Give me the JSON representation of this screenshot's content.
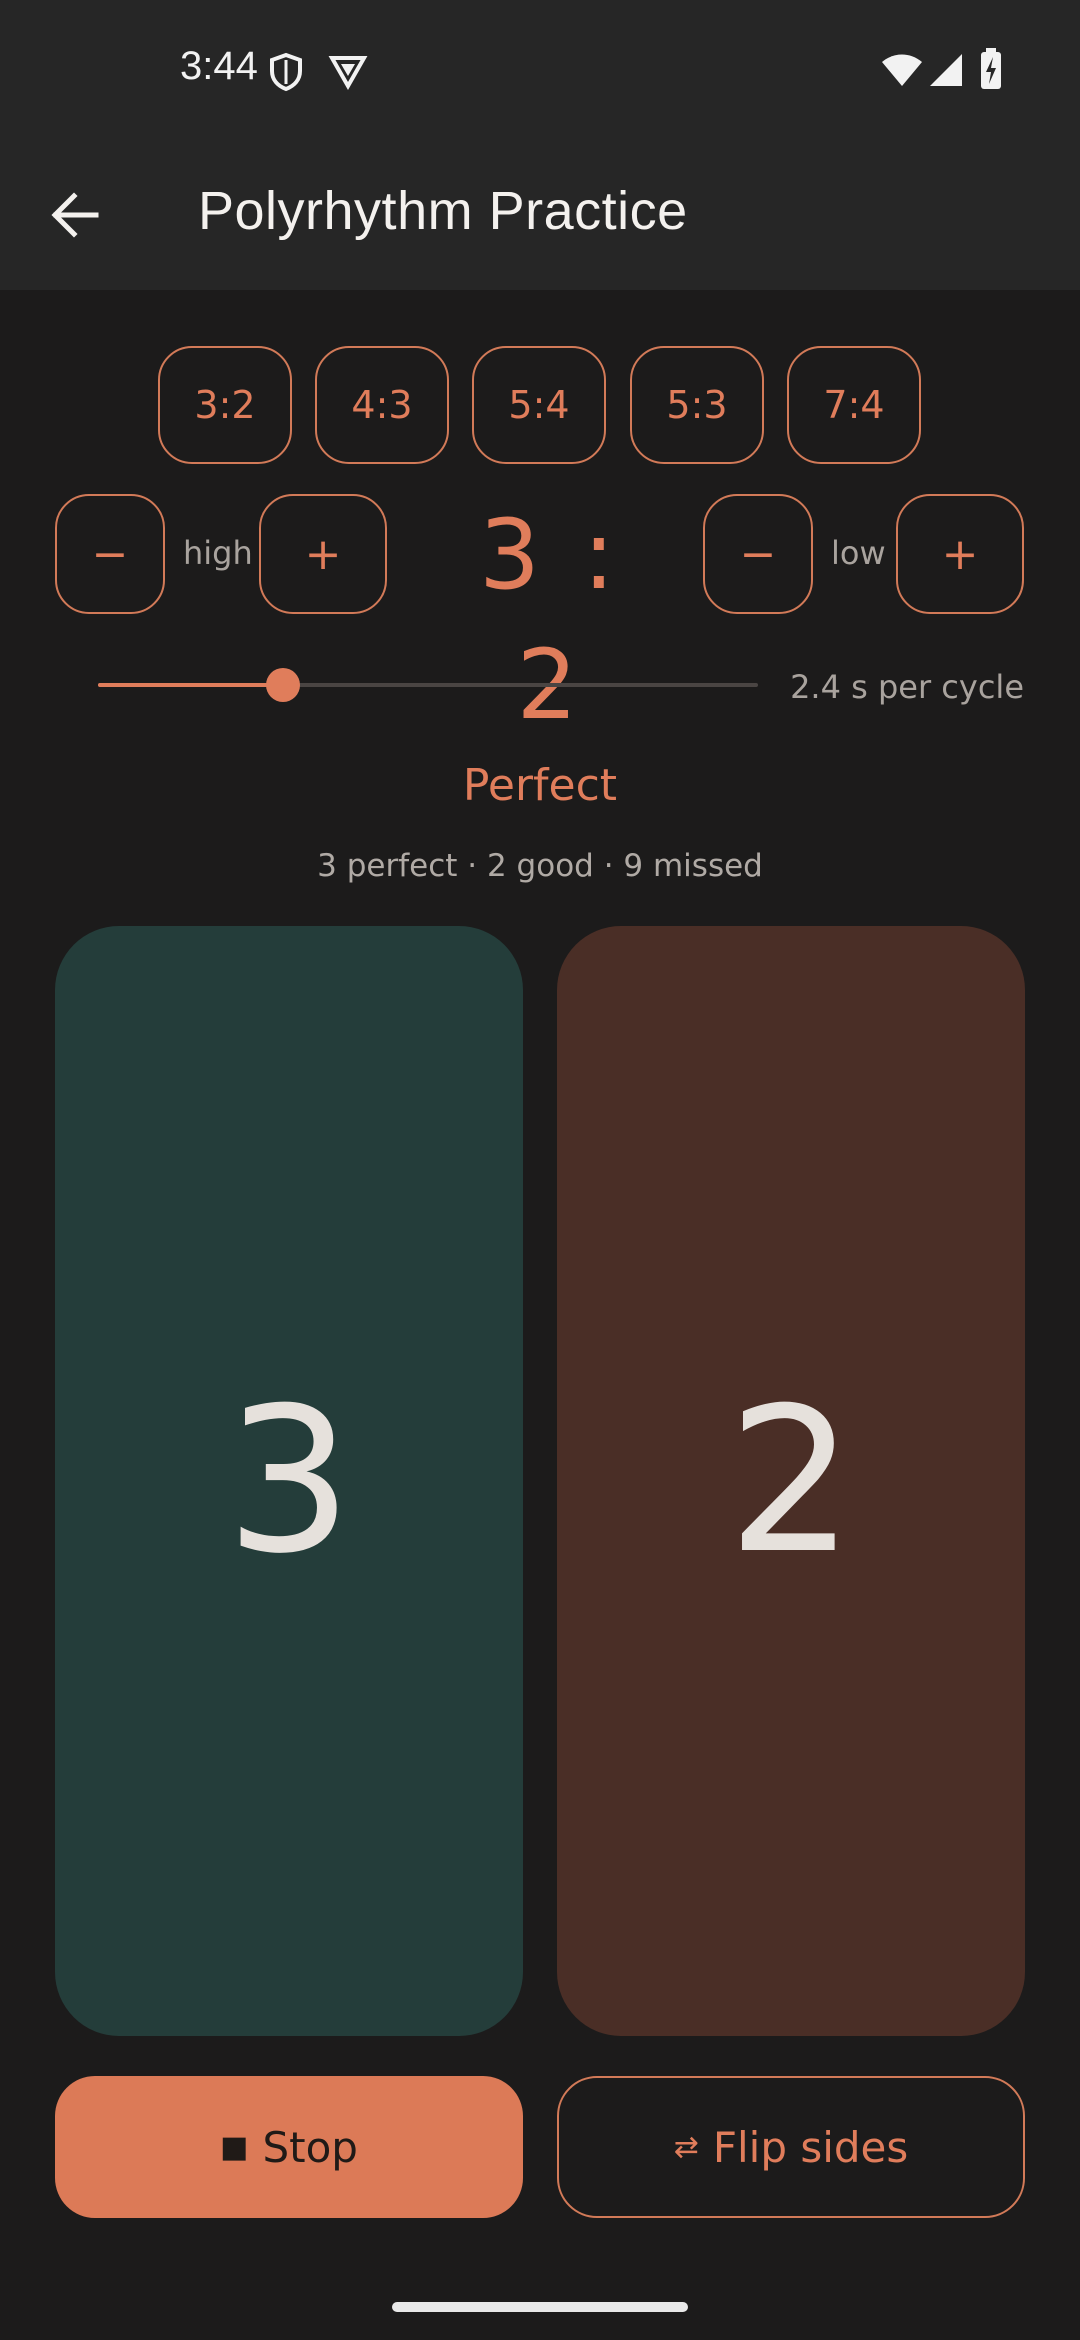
{
  "status_bar": {
    "time": "3:44",
    "icons": [
      "shield-icon",
      "vpn-icon",
      "wifi-icon",
      "signal-icon",
      "battery-charging-icon"
    ]
  },
  "app_bar": {
    "title": "Polyrhythm Practice",
    "back_icon": "arrow-left-icon"
  },
  "presets": [
    "3:2",
    "4:3",
    "5:4",
    "5:3",
    "7:4"
  ],
  "high": {
    "minus": "−",
    "label": "high",
    "plus": "+"
  },
  "ratio_display": "3 : 2",
  "low": {
    "minus": "−",
    "label": "low",
    "plus": "+"
  },
  "tempo": {
    "slider_fraction": 0.28,
    "label": "2.4 s per cycle"
  },
  "feedback": {
    "title": "Perfect",
    "score": "3 perfect · 2 good · 9 missed"
  },
  "pads": {
    "left": "3",
    "right": "2"
  },
  "actions": {
    "stop_icon": "■",
    "stop_label": "Stop",
    "flip_icon": "⇄",
    "flip_label": "Flip sides"
  },
  "colors": {
    "accent": "#e07d5b",
    "background": "#1c1b1b",
    "bar": "#262626",
    "pad_left": "#243d3a",
    "pad_right": "#4a2e26"
  }
}
